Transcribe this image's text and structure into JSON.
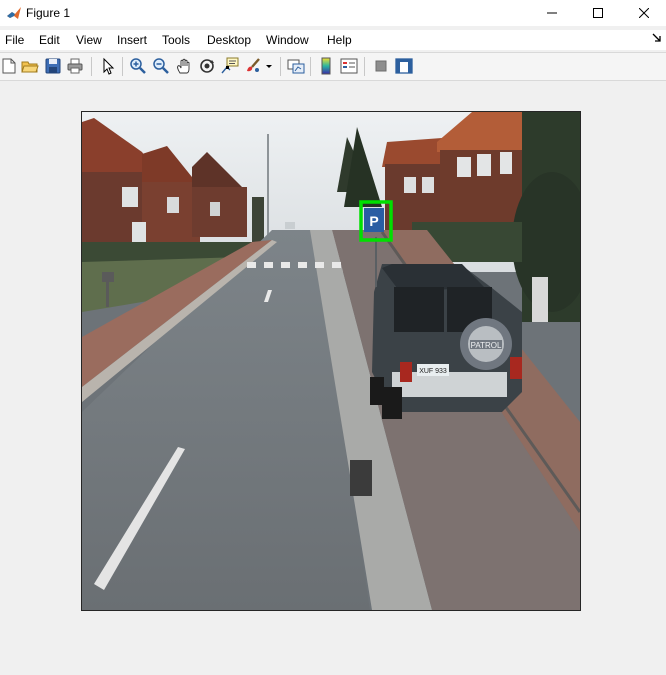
{
  "window": {
    "title": "Figure 1"
  },
  "menu": {
    "items": [
      "File",
      "Edit",
      "View",
      "Insert",
      "Tools",
      "Desktop",
      "Window",
      "Help"
    ]
  },
  "toolbar": {
    "icons": [
      "new-figure-icon",
      "open-file-icon",
      "save-icon",
      "print-icon",
      "select-pointer-icon",
      "zoom-in-icon",
      "zoom-out-icon",
      "pan-hand-icon",
      "rotate-3d-icon",
      "data-cursor-icon",
      "brush-icon",
      "brush-dropdown-icon",
      "link-plot-icon",
      "colorbar-icon",
      "legend-icon",
      "hide-plot-tools-icon",
      "show-plot-tools-icon"
    ]
  },
  "figure": {
    "image_description_free": true,
    "detection_box_color": "#00e000",
    "sign_text": "P",
    "spare_tire_text": "PATROL",
    "license_plate_text": "XUF 933"
  },
  "colors": {
    "window_bg": "#f0f0f0",
    "titlebar_bg": "#ffffff",
    "detection_box": "#00e000"
  }
}
